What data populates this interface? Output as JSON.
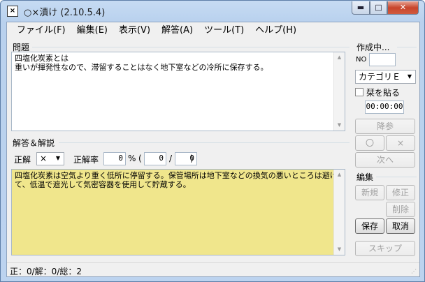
{
  "window": {
    "title": "○×漬け (2.10.5.4)",
    "app_icon_glyph": "×",
    "min_glyph": "▬",
    "max_glyph": "□",
    "close_glyph": "✕"
  },
  "menu": [
    {
      "label": "ファイル(F)"
    },
    {
      "label": "編集(E)"
    },
    {
      "label": "表示(V)"
    },
    {
      "label": "解答(A)"
    },
    {
      "label": "ツール(T)"
    },
    {
      "label": "ヘルプ(H)"
    }
  ],
  "question": {
    "group_label": "問題",
    "text": "四塩化炭素とは\n重いが揮発性なので、滞留することはなく地下室などの冷所に保存する。"
  },
  "answer": {
    "group_label": "解答＆解説",
    "correct_label": "正解",
    "correct_value": "×",
    "rate_label": "正解率",
    "rate_value": "0",
    "percent": "%",
    "open_paren": "(",
    "correct_count": "0",
    "slash": "/",
    "total_count": "0",
    "close_paren": ")",
    "text": "四塩化炭素は空気より重く低所に停留する。保管場所は地下室などの換気の悪いところは避けて、低温で遮光して気密容器を使用して貯蔵する。"
  },
  "side": {
    "creating_label": "作成中...",
    "no_label": "NO",
    "no_value": "",
    "category_value": "カテゴリＥ",
    "sticky_label": "栞を貼る",
    "timer": "00:00:00",
    "give_up": "降参",
    "circle": "〇",
    "cross": "×",
    "next": "次へ",
    "edit_label": "編集",
    "new": "新規",
    "modify": "修正",
    "delete": "削除",
    "save": "保存",
    "cancel": "取消",
    "skip": "スキップ"
  },
  "status": {
    "text": "正：0/解：0/総：2"
  },
  "colors": {
    "answer_bg": "#f0e68c"
  }
}
